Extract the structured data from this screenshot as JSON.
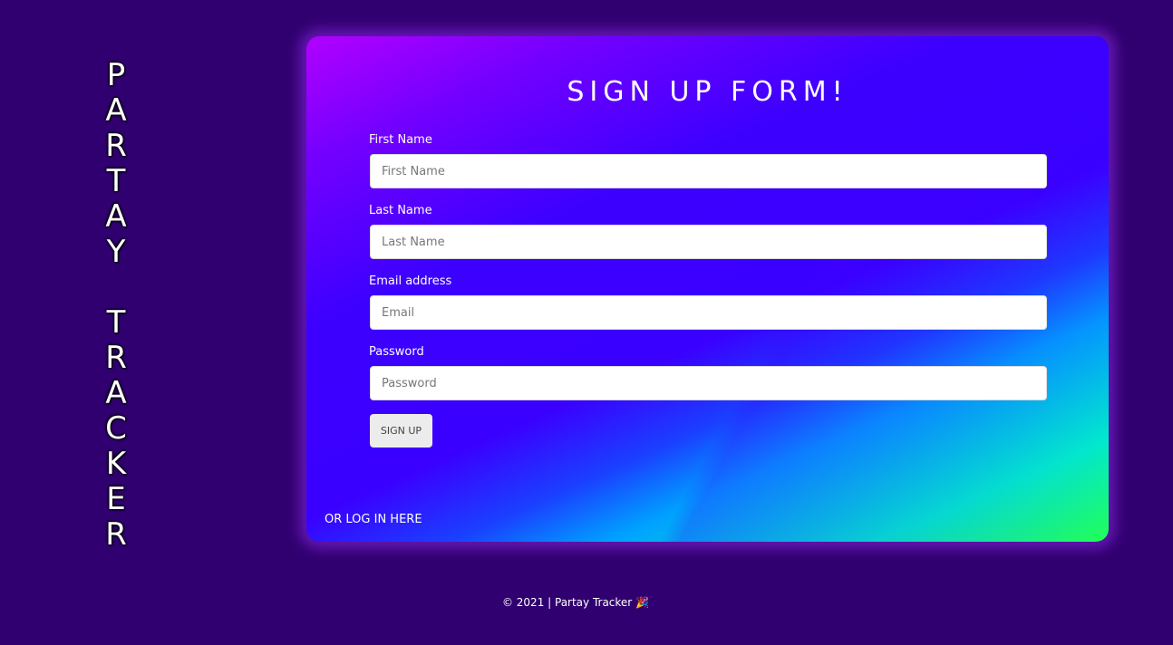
{
  "sidebar": {
    "letters": [
      "P",
      "A",
      "R",
      "T",
      "A",
      "Y",
      "",
      "T",
      "R",
      "A",
      "C",
      "K",
      "E",
      "R"
    ]
  },
  "form": {
    "title": "SIGN UP FORM!",
    "fields": [
      {
        "label": "First Name",
        "placeholder": "First Name",
        "value": ""
      },
      {
        "label": "Last Name",
        "placeholder": "Last Name",
        "value": ""
      },
      {
        "label": "Email address",
        "placeholder": "Email",
        "value": ""
      },
      {
        "label": "Password",
        "placeholder": "Password",
        "value": ""
      }
    ],
    "submit_label": "SIGN UP",
    "login_link_label": "OR LOG IN HERE"
  },
  "footer": {
    "text": "© 2021 | Partay Tracker",
    "emoji": "🎉"
  },
  "colors": {
    "background": "#310070",
    "card_gradient": [
      "#22ff55",
      "#00f0cc",
      "#00a0ff",
      "#3c00ff",
      "#b200ff"
    ]
  }
}
